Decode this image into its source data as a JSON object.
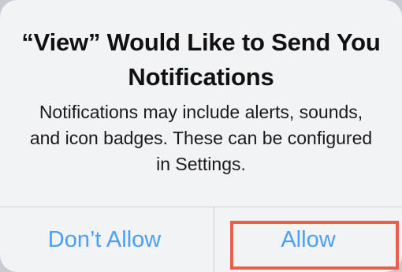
{
  "alert": {
    "title": "“View” Would Like to Send You Notifications",
    "message": "Notifications may include alerts, sounds, and icon badges. These can be configured in Settings.",
    "buttons": {
      "dont_allow": "Don’t Allow",
      "allow": "Allow"
    }
  },
  "colors": {
    "button_text": "#4a9ff5",
    "highlight_border": "#e8604a",
    "alert_background": "#f2f3f5"
  }
}
